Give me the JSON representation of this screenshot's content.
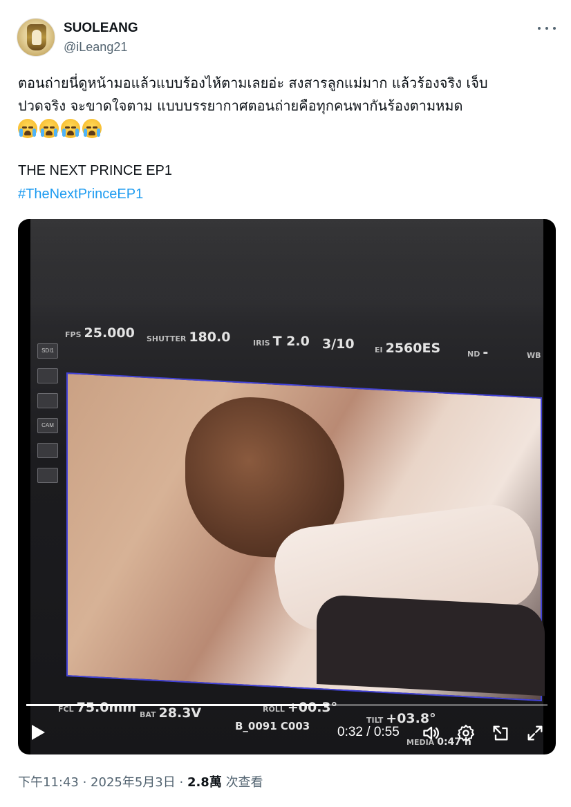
{
  "author": {
    "name": "SUOLEANG",
    "handle": "@iLeang21"
  },
  "tweet": {
    "text_line1": "ตอนถ่ายนี่ดูหน้ามอแล้วแบบร้องไห้ตามเลยอ่ะ สงสารลูกแม่มาก แล้วร้องจริง เจ็บ",
    "text_line2": "ปวดจริง จะขาดใจตาม แบบบรรยากาศตอนถ่ายคือทุกคนพากันร้องตามหมด",
    "emoji": [
      "loudly-crying-face",
      "loudly-crying-face",
      "loudly-crying-face",
      "loudly-crying-face"
    ],
    "title": "THE NEXT PRINCE EP1",
    "hashtag": "#TheNextPrinceEP1"
  },
  "video": {
    "hud_top": [
      {
        "label": "FPS",
        "value": "25.000"
      },
      {
        "label": "SHUTTER",
        "value": "180.0"
      },
      {
        "label": "IRIS",
        "value": "T 2.0"
      },
      {
        "label": "",
        "value": "3/10"
      },
      {
        "label": "EI",
        "value": "2560ES"
      },
      {
        "label": "ND",
        "value": "-"
      },
      {
        "label": "",
        "value": "WB"
      }
    ],
    "hud_bottom": [
      {
        "label": "FCL",
        "value": "75.0mm"
      },
      {
        "label": "BAT",
        "value": "28.3V"
      },
      {
        "label": "ROLL",
        "value": "+00.3°"
      },
      {
        "label": "",
        "value": "B_0091  C003"
      },
      {
        "label": "TILT",
        "value": "+03.8°"
      },
      {
        "label": "MEDIA",
        "value": "0:47 h"
      }
    ],
    "side_panel": {
      "sdi": "SDI1",
      "cam": "CAM"
    },
    "progress_fraction": 0.58,
    "current_time": "0:32",
    "duration": "0:55",
    "time_display": "0:32 / 0:55"
  },
  "meta": {
    "time": "下午11:43",
    "date": "2025年5月3日",
    "views_count": "2.8萬",
    "views_label": "次查看"
  },
  "colors": {
    "link": "#1d9bf0",
    "secondary_text": "#536471",
    "frame_border": "#4242d8"
  }
}
